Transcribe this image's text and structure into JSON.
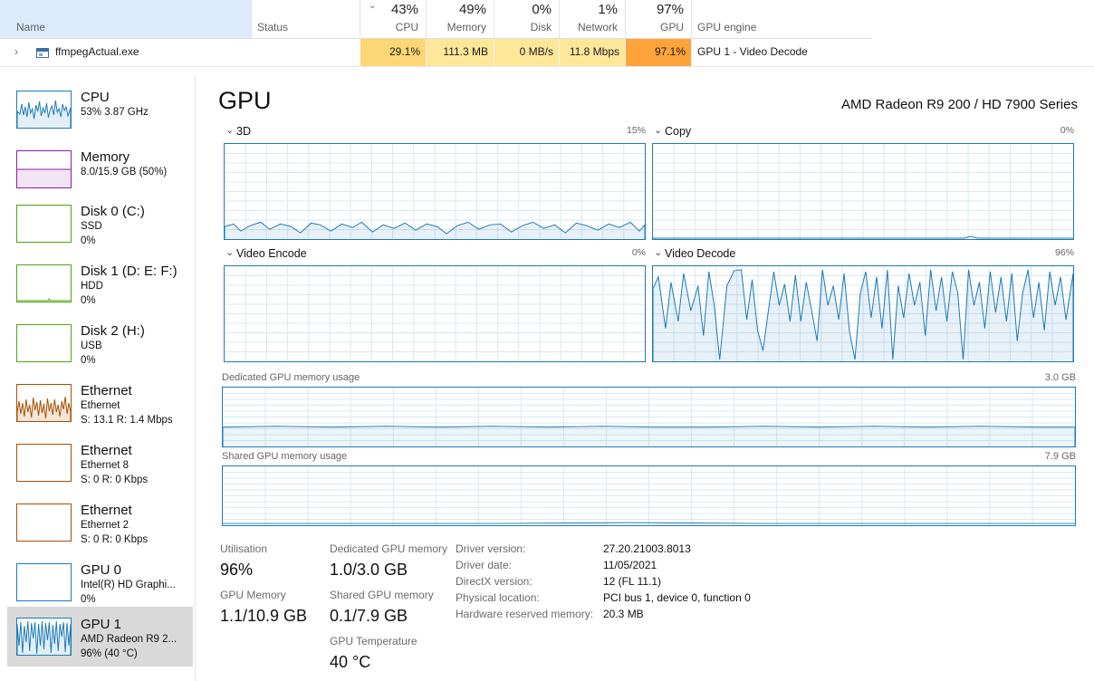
{
  "colors": {
    "cpu_accent": "#1c7ab8",
    "memory_accent": "#8b1ea6",
    "disk_accent": "#4da60c",
    "ethernet_accent": "#a74f01",
    "gpu_accent": "#1c7ab8",
    "heat_light": "#ffe79a",
    "heat_mid": "#fdd675",
    "heat_hot": "#fca43a",
    "selected_header": "#dcebfc"
  },
  "table": {
    "headers": {
      "name": "Name",
      "status": "Status",
      "cpu": {
        "pct": "43%",
        "label": "CPU"
      },
      "memory": {
        "pct": "49%",
        "label": "Memory"
      },
      "disk": {
        "pct": "0%",
        "label": "Disk"
      },
      "network": {
        "pct": "1%",
        "label": "Network"
      },
      "gpu": {
        "pct": "97%",
        "label": "GPU"
      },
      "gpu_engine": "GPU engine"
    },
    "sort_icon": "chevron-down-icon",
    "rows": [
      {
        "name": "ffmpegActual.exe",
        "icon": "app-window-icon",
        "status": "",
        "cpu": "29.1%",
        "memory": "111.3 MB",
        "disk": "0 MB/s",
        "network": "11.8 Mbps",
        "gpu": "97.1%",
        "gpu_engine": "GPU 1 - Video Decode"
      }
    ]
  },
  "sidebar": {
    "items": [
      {
        "title": "CPU",
        "line1": "53% 3.87 GHz",
        "line2": "",
        "color": "#1c7ab8"
      },
      {
        "title": "Memory",
        "line1": "8.0/15.9 GB (50%)",
        "line2": "",
        "color": "#8b1ea6"
      },
      {
        "title": "Disk 0 (C:)",
        "line1": "SSD",
        "line2": "0%",
        "color": "#4da60c"
      },
      {
        "title": "Disk 1 (D: E: F:)",
        "line1": "HDD",
        "line2": "0%",
        "color": "#4da60c"
      },
      {
        "title": "Disk 2 (H:)",
        "line1": "USB",
        "line2": "0%",
        "color": "#4da60c"
      },
      {
        "title": "Ethernet",
        "line1": "Ethernet",
        "line2": "S: 13.1 R: 1.4 Mbps",
        "color": "#a74f01"
      },
      {
        "title": "Ethernet",
        "line1": "Ethernet 8",
        "line2": "S: 0 R: 0 Kbps",
        "color": "#a74f01"
      },
      {
        "title": "Ethernet",
        "line1": "Ethernet 2",
        "line2": "S: 0 R: 0 Kbps",
        "color": "#a74f01"
      },
      {
        "title": "GPU 0",
        "line1": "Intel(R) HD Graphi...",
        "line2": "0%",
        "color": "#1c7ab8"
      },
      {
        "title": "GPU 1",
        "line1": "AMD Radeon R9 2...",
        "line2": "96% (40 °C)",
        "color": "#1c7ab8",
        "selected": true
      }
    ]
  },
  "gpu": {
    "title": "GPU",
    "model": "AMD Radeon R9 200 / HD 7900 Series",
    "engines": [
      {
        "name": "3D",
        "pct": "15%"
      },
      {
        "name": "Copy",
        "pct": "0%"
      },
      {
        "name": "Video Encode",
        "pct": "0%"
      },
      {
        "name": "Video Decode",
        "pct": "96%"
      }
    ],
    "dedicated_memory": {
      "label": "Dedicated GPU memory usage",
      "max": "3.0 GB"
    },
    "shared_memory": {
      "label": "Shared GPU memory usage",
      "max": "7.9 GB"
    },
    "stats": {
      "utilisation": {
        "label": "Utilisation",
        "value": "96%"
      },
      "gpu_memory": {
        "label": "GPU Memory",
        "value": "1.1/10.9 GB"
      },
      "dedicated": {
        "label": "Dedicated GPU memory",
        "value": "1.0/3.0 GB"
      },
      "shared": {
        "label": "Shared GPU memory",
        "value": "0.1/7.9 GB"
      },
      "temperature": {
        "label": "GPU Temperature",
        "value": "40 °C"
      }
    },
    "details": [
      {
        "key": "Driver version:",
        "value": "27.20.21003.8013"
      },
      {
        "key": "Driver date:",
        "value": "11/05/2021"
      },
      {
        "key": "DirectX version:",
        "value": "12 (FL 11.1)"
      },
      {
        "key": "Physical location:",
        "value": "PCI bus 1, device 0, function 0"
      },
      {
        "key": "Hardware reserved memory:",
        "value": "20.3 MB"
      }
    ]
  }
}
